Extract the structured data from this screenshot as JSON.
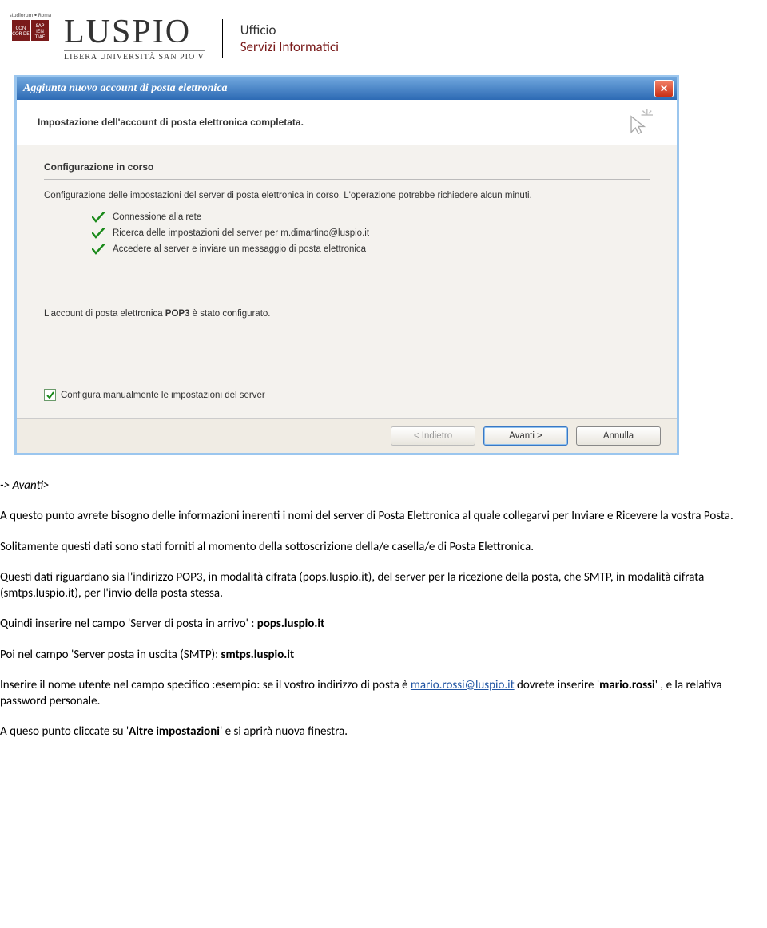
{
  "header": {
    "seal_top": "studiorum • Roma",
    "seal_left": "CON\nCOR\nDE",
    "seal_right": "SAP\nIEN\nTIAE",
    "brand": "LUSPIO",
    "brand_sub": "LIBERA UNIVERSITÀ SAN PIO V",
    "office_l1": "Ufficio",
    "office_l2": "Servizi Informatici"
  },
  "dialog": {
    "title": "Aggiunta nuovo account di posta elettronica",
    "subheader": "Impostazione dell'account di posta elettronica completata.",
    "section_title": "Configurazione in corso",
    "intro": "Configurazione delle impostazioni del server di posta elettronica in corso. L'operazione potrebbe richiedere alcun minuti.",
    "checks": {
      "0": "Connessione alla rete",
      "1": "Ricerca delle impostazioni del server per m.dimartino@luspio.it",
      "2": "Accedere al server e inviare un messaggio di posta elettronica"
    },
    "configured_prefix": "L'account di posta elettronica ",
    "configured_bold": "POP3",
    "configured_suffix": " è stato configurato.",
    "manual_label": "Configura manualmente le impostazioni del server",
    "buttons": {
      "back": "< Indietro",
      "next": "Avanti >",
      "cancel": "Annulla"
    }
  },
  "doc": {
    "step": "-> Avanti>",
    "p1": "A questo punto avrete bisogno delle informazioni inerenti i nomi del server di Posta Elettronica al quale collegarvi per Inviare e Ricevere la vostra Posta.",
    "p2": "Solitamente questi dati sono stati forniti al momento della sottoscrizione della/e casella/e di Posta Elettronica.",
    "p3": "Questi dati riguardano sia l'indirizzo POP3, in modalità cifrata (pops.luspio.it), del server per la ricezione della posta, che SMTP, in modalità cifrata (smtps.luspio.it), per l'invio della posta stessa.",
    "p4_prefix": "Quindi inserire nel campo 'Server di posta in arrivo' : ",
    "p4_bold": "pops.luspio.it",
    "p5_prefix": "Poi  nel campo 'Server posta in uscita (SMTP): ",
    "p5_bold": "smtps.luspio.it",
    "p6_prefix": "Inserire il nome utente nel campo specifico :esempio: se il vostro indirizzo di posta è ",
    "p6_link": "mario.rossi@luspio.it",
    "p6_mid": " dovrete inserire '",
    "p6_bold": "mario.rossi",
    "p6_suffix": "' , e la relativa password personale.",
    "p7_prefix": "A queso punto cliccate su '",
    "p7_bold": "Altre impostazioni",
    "p7_suffix": "' e si aprirà nuova finestra."
  }
}
